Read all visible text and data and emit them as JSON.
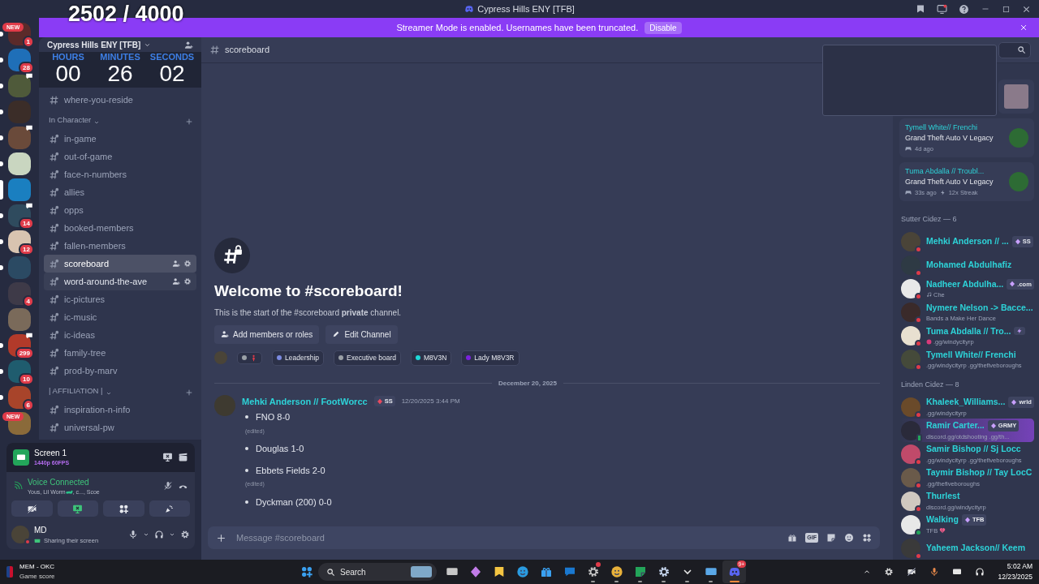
{
  "stream_overlay": {
    "counter": "2502 / 4000",
    "timer": [
      {
        "label": "HOURS",
        "value": "00"
      },
      {
        "label": "MINUTES",
        "value": "26"
      },
      {
        "label": "SECONDS",
        "value": "02"
      }
    ]
  },
  "window": {
    "title": "Cypress Hills ENY [TFB]"
  },
  "banner": {
    "text": "Streamer Mode is enabled. Usernames have been truncated.",
    "button": "Disable"
  },
  "servers": [
    {
      "new_label": "NEW",
      "badge": "1",
      "unread": true,
      "selected": false,
      "bubble": false
    },
    {
      "badge": "28",
      "unread": true,
      "selected": false,
      "bubble": false
    },
    {
      "unread": true,
      "selected": false,
      "bubble": true
    },
    {
      "unread": true,
      "selected": false,
      "bubble": false
    },
    {
      "unread": true,
      "selected": false,
      "bubble": true
    },
    {
      "unread": true,
      "selected": false,
      "bubble": false
    },
    {
      "unread": false,
      "selected": true,
      "bubble": false
    },
    {
      "badge": "14",
      "unread": true,
      "selected": false,
      "bubble": true
    },
    {
      "badge": "12",
      "unread": true,
      "selected": false,
      "bubble": false
    },
    {
      "unread": true,
      "selected": false,
      "bubble": false
    },
    {
      "badge": "4",
      "unread": false,
      "selected": false,
      "bubble": false
    },
    {
      "unread": false,
      "selected": false,
      "bubble": false
    },
    {
      "badge": "299",
      "unread": true,
      "selected": false,
      "bubble": true
    },
    {
      "badge": "10",
      "unread": true,
      "selected": false,
      "bubble": false
    },
    {
      "badge": "6",
      "unread": true,
      "selected": false,
      "bubble": false
    },
    {
      "new_label": "NEW",
      "unread": false,
      "selected": false,
      "bubble": false
    }
  ],
  "sidebar": {
    "server_name": "Cypress Hills ENY [TFB]",
    "sections": [
      {
        "channels": [
          {
            "name": "where-you-reside",
            "private": false,
            "selected": false,
            "hovered": false
          }
        ]
      },
      {
        "category": "In Character",
        "channels": [
          {
            "name": "in-game",
            "private": true,
            "selected": false,
            "hovered": false
          },
          {
            "name": "out-of-game",
            "private": true,
            "selected": false,
            "hovered": false
          },
          {
            "name": "face-n-numbers",
            "private": true,
            "selected": false,
            "hovered": false
          },
          {
            "name": "allies",
            "private": true,
            "selected": false,
            "hovered": false
          },
          {
            "name": "opps",
            "private": true,
            "selected": false,
            "hovered": false
          },
          {
            "name": "booked-members",
            "private": true,
            "selected": false,
            "hovered": false
          },
          {
            "name": "fallen-members",
            "private": true,
            "selected": false,
            "hovered": false
          },
          {
            "name": "scoreboard",
            "private": true,
            "selected": true,
            "hovered": false
          },
          {
            "name": "word-around-the-ave",
            "private": true,
            "selected": false,
            "hovered": true
          },
          {
            "name": "ic-pictures",
            "private": true,
            "selected": false,
            "hovered": false
          },
          {
            "name": "ic-music",
            "private": true,
            "selected": false,
            "hovered": false
          },
          {
            "name": "ic-ideas",
            "private": true,
            "selected": false,
            "hovered": false
          },
          {
            "name": "family-tree",
            "private": true,
            "selected": false,
            "hovered": false
          },
          {
            "name": "prod-by-marv",
            "private": true,
            "selected": false,
            "hovered": false
          }
        ]
      },
      {
        "category": "| AFFILIATION |",
        "channels": [
          {
            "name": "inspiration-n-info",
            "private": true,
            "selected": false,
            "hovered": false
          },
          {
            "name": "universal-pw",
            "private": true,
            "selected": false,
            "hovered": false
          }
        ]
      }
    ]
  },
  "user_panel": {
    "stream": {
      "title": "Screen 1",
      "quality": "1440p 60FPS"
    },
    "voice": {
      "status": "Voice Connected",
      "members_before": "Yous, Lil Worm",
      "members_after": ", c..., Scoe"
    },
    "user": {
      "name": "MD",
      "status": "Sharing their screen"
    }
  },
  "channel_header": {
    "name": "scoreboard"
  },
  "welcome": {
    "title": "Welcome to #scoreboard!",
    "text": "This is the start of the #scoreboard **private** channel.",
    "buttons": [
      "Add members or roles",
      "Edit Channel"
    ]
  },
  "roles": [
    {
      "kind": "icon",
      "color": "#9aa0a6"
    },
    {
      "kind": "text",
      "name": "Leadership",
      "color": "#7b8ae0"
    },
    {
      "kind": "text",
      "name": "Executive board",
      "color": "#9aa0a6"
    },
    {
      "kind": "text",
      "name": "M8V3N",
      "color": "#1ed8d8"
    },
    {
      "kind": "text",
      "name": "Lady M8V3R",
      "color": "#7a22dd"
    }
  ],
  "date_divider": "December 20, 2025",
  "message": {
    "author": "Mehki Anderson // FootWorcc",
    "tag": "SS",
    "time": "12/20/2025 3:44 PM",
    "items": [
      {
        "text": "FNO 8-0",
        "note": "(edited)"
      },
      {
        "text": "Douglas 1-0"
      },
      {
        "text": "Ebbets Fields 2-0",
        "note": "(edited)"
      },
      {
        "text": "Dyckman (200) 0-0"
      }
    ]
  },
  "composer": {
    "placeholder": "Message #scoreboard",
    "gif": "GIF"
  },
  "activities": [
    {
      "kind": "art"
    },
    {
      "kind": "game",
      "name": "Tymell White// Frenchi",
      "game": "Grand Theft Auto V Legacy",
      "time": "4d ago"
    },
    {
      "kind": "game",
      "name": "Tuma Abdalla // Troubl...",
      "game": "Grand Theft Auto V Legacy",
      "time": "33s ago",
      "streak": "12x Streak"
    }
  ],
  "member_groups": [
    {
      "title": "Sutter Cidez — 6",
      "members": [
        {
          "kind": "plain",
          "name": "Mehki Anderson // ...",
          "emblem": true,
          "tag": "SS",
          "color": "#e03b49",
          "mobile": false,
          "highlighted": false
        },
        {
          "kind": "plain",
          "name": "Mohamed Abdulhafiz",
          "color": "#e03b49",
          "mobile": false,
          "highlighted": false
        },
        {
          "kind": "music",
          "name": "Nadheer Abdulha...",
          "emblem": true,
          "tag": ".com",
          "color": "#e03b49",
          "mobile": false,
          "subtitle": "Che",
          "highlighted": false
        },
        {
          "kind": "plain",
          "name": "Nymere Nelson -> Bacce...",
          "color": "#e03b49",
          "mobile": false,
          "subtitle": "Bands a Make Her Dance",
          "highlighted": false
        },
        {
          "kind": "emoji",
          "name": "Tuma Abdalla // Tro...",
          "emblem": true,
          "color": "#e03b49",
          "mobile": false,
          "subtitle": ".gg/windycityrp",
          "highlighted": false
        },
        {
          "kind": "plain",
          "name": "Tymell White// Frenchi",
          "color": "#e03b49",
          "mobile": false,
          "subtitle": ".gg/windycityrp .gg/thefiveboroughs",
          "highlighted": false
        }
      ]
    },
    {
      "title": "Linden Cidez — 8",
      "members": [
        {
          "kind": "plain",
          "name": "Khaleek_Williams...",
          "emblem": true,
          "tag": "wrld",
          "color": "#e03b49",
          "mobile": false,
          "subtitle": ".gg/windycityrp",
          "highlighted": false
        },
        {
          "kind": "plain",
          "name": "Ramir Carter...",
          "emblem": true,
          "tag": "GRMY",
          "color": "#23a55a",
          "mobile": true,
          "subtitle": "discord.gg/otdshooting .gg/th...",
          "highlighted": true
        },
        {
          "kind": "plain",
          "name": "Samir Bishop // Sj Locc",
          "color": "#e03b49",
          "mobile": false,
          "subtitle": ".gg/windycityrp .gg/thefiveboroughs",
          "highlighted": false
        },
        {
          "kind": "plain",
          "name": "Taymir Bishop // Tay LocC",
          "color": "#e03b49",
          "mobile": false,
          "subtitle": ".gg/thefiveboroughs",
          "highlighted": false
        },
        {
          "kind": "plain",
          "name": "Thurlest",
          "color": "#e03b49",
          "mobile": false,
          "subtitle": "discord.gg/windycityrp",
          "highlighted": false
        },
        {
          "kind": "heart",
          "name": "Walking",
          "emblem": true,
          "tag": "TFB",
          "color": "#23a55a",
          "mobile": false,
          "subtitle": "TFB",
          "highlighted": false
        },
        {
          "kind": "plain",
          "name": "Yaheem Jackson// Keem",
          "color": "#e03b49",
          "mobile": false,
          "highlighted": false
        }
      ]
    }
  ],
  "taskbar": {
    "media": {
      "title": "MEM - OKC",
      "subtitle": "Game score"
    },
    "search": "Search",
    "apps": [
      {
        "running": false,
        "selected": false,
        "alert": false
      },
      {
        "running": false,
        "selected": false,
        "alert": false
      },
      {
        "running": false,
        "selected": false,
        "alert": false
      },
      {
        "running": false,
        "selected": false,
        "alert": false
      },
      {
        "running": false,
        "selected": false,
        "alert": false
      },
      {
        "running": false,
        "selected": false,
        "alert": false
      },
      {
        "running": true,
        "selected": false,
        "alert": true
      },
      {
        "running": true,
        "selected": false,
        "alert": false
      },
      {
        "running": true,
        "selected": false,
        "alert": false
      },
      {
        "running": true,
        "selected": false,
        "alert": false
      },
      {
        "running": true,
        "selected": false,
        "alert": false
      },
      {
        "running": true,
        "selected": false,
        "alert": false
      },
      {
        "running": true,
        "selected": true,
        "alert": false,
        "badge": "9+"
      }
    ],
    "clock": {
      "time": "5:02 AM",
      "date": "12/23/2025"
    }
  }
}
